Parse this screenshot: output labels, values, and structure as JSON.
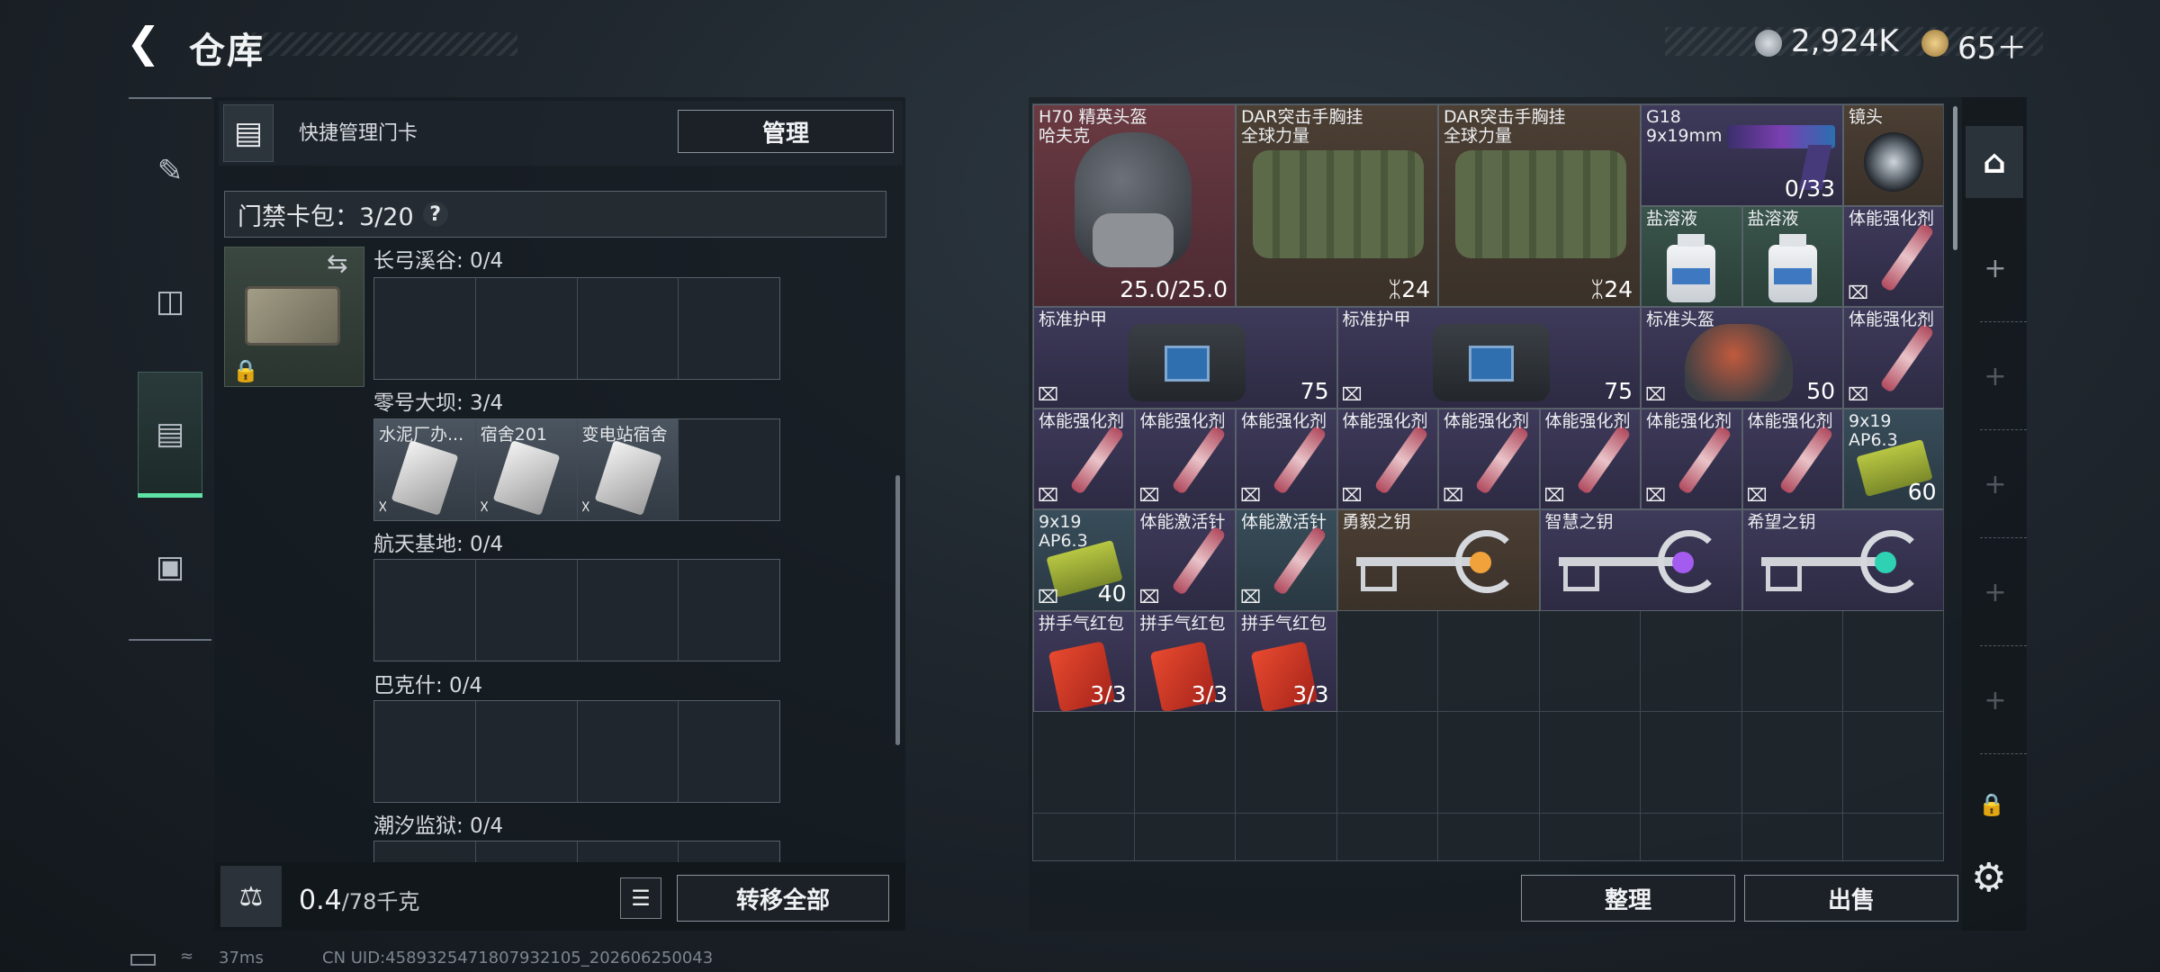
{
  "header": {
    "title": "仓库",
    "back_icon": "chevron-left-icon",
    "currency1": "2,924K",
    "currency2": "65＋"
  },
  "left": {
    "quick_title": "快捷管理门卡",
    "manage_label": "管理",
    "pack_label": "门禁卡包：3/20",
    "pack_help": "?",
    "groups": [
      {
        "title": "长弓溪谷: 0/4"
      },
      {
        "title": "零号大坝: 3/4",
        "cards": [
          "水泥厂办...",
          "宿舍201",
          "变电站宿舍"
        ]
      },
      {
        "title": "航天基地: 0/4"
      },
      {
        "title": "巴克什: 0/4"
      },
      {
        "title": "潮汐监狱: 0/4"
      }
    ],
    "weight": "0.4",
    "weight_max": "/78千克",
    "transfer_label": "转移全部"
  },
  "right": {
    "items": [
      {
        "name": "H70 精英头盔\n哈夫克",
        "val": "25.0/25.0",
        "bg": "red"
      },
      {
        "name": "DAR突击手胸挂\n全球力量",
        "val": "ᛯ24",
        "bg": "brown"
      },
      {
        "name": "DAR突击手胸挂\n全球力量",
        "val": "ᛯ24",
        "bg": "brown"
      },
      {
        "name": "G18\n9x19mm",
        "val": "0/33",
        "bg": "purple"
      },
      {
        "name": "镜头",
        "val": "",
        "bg": "brown"
      },
      {
        "name": "盐溶液",
        "val": "",
        "bg": "green"
      },
      {
        "name": "盐溶液",
        "val": "",
        "bg": "green"
      },
      {
        "name": "体能强化剂",
        "val": "",
        "bg": "purple"
      },
      {
        "name": "标准护甲",
        "val": "75",
        "bg": "purple"
      },
      {
        "name": "标准护甲",
        "val": "75",
        "bg": "purple"
      },
      {
        "name": "标准头盔",
        "val": "50",
        "bg": "purple"
      },
      {
        "name": "体能强化剂",
        "val": "",
        "bg": "purple"
      },
      {
        "name": "体能强化剂",
        "val": "",
        "bg": "purple"
      },
      {
        "name": "体能强化剂",
        "val": "",
        "bg": "purple"
      },
      {
        "name": "体能强化剂",
        "val": "",
        "bg": "purple"
      },
      {
        "name": "体能强化剂",
        "val": "",
        "bg": "purple"
      },
      {
        "name": "体能强化剂",
        "val": "",
        "bg": "purple"
      },
      {
        "name": "体能强化剂",
        "val": "",
        "bg": "purple"
      },
      {
        "name": "体能强化剂",
        "val": "",
        "bg": "purple"
      },
      {
        "name": "体能强化剂",
        "val": "",
        "bg": "purple"
      },
      {
        "name": "9x19\nAP6.3",
        "val": "60",
        "bg": "teal"
      },
      {
        "name": "9x19\nAP6.3",
        "val": "40",
        "bg": "teal"
      },
      {
        "name": "体能激活针",
        "val": "",
        "bg": "purple"
      },
      {
        "name": "体能激活针",
        "val": "",
        "bg": "teal"
      },
      {
        "name": "勇毅之钥",
        "val": "",
        "bg": "brown"
      },
      {
        "name": "智慧之钥",
        "val": "",
        "bg": "purple"
      },
      {
        "name": "希望之钥",
        "val": "",
        "bg": "purple"
      },
      {
        "name": "拼手气红包",
        "val": "3/3",
        "bg": "purple"
      },
      {
        "name": "拼手气红包",
        "val": "3/3",
        "bg": "purple"
      },
      {
        "name": "拼手气红包",
        "val": "3/3",
        "bg": "purple"
      }
    ],
    "sort_label": "整理",
    "sell_label": "出售"
  },
  "status": {
    "ping": "37ms",
    "uid": "CN UID:4589325471807932105_202606250043"
  }
}
